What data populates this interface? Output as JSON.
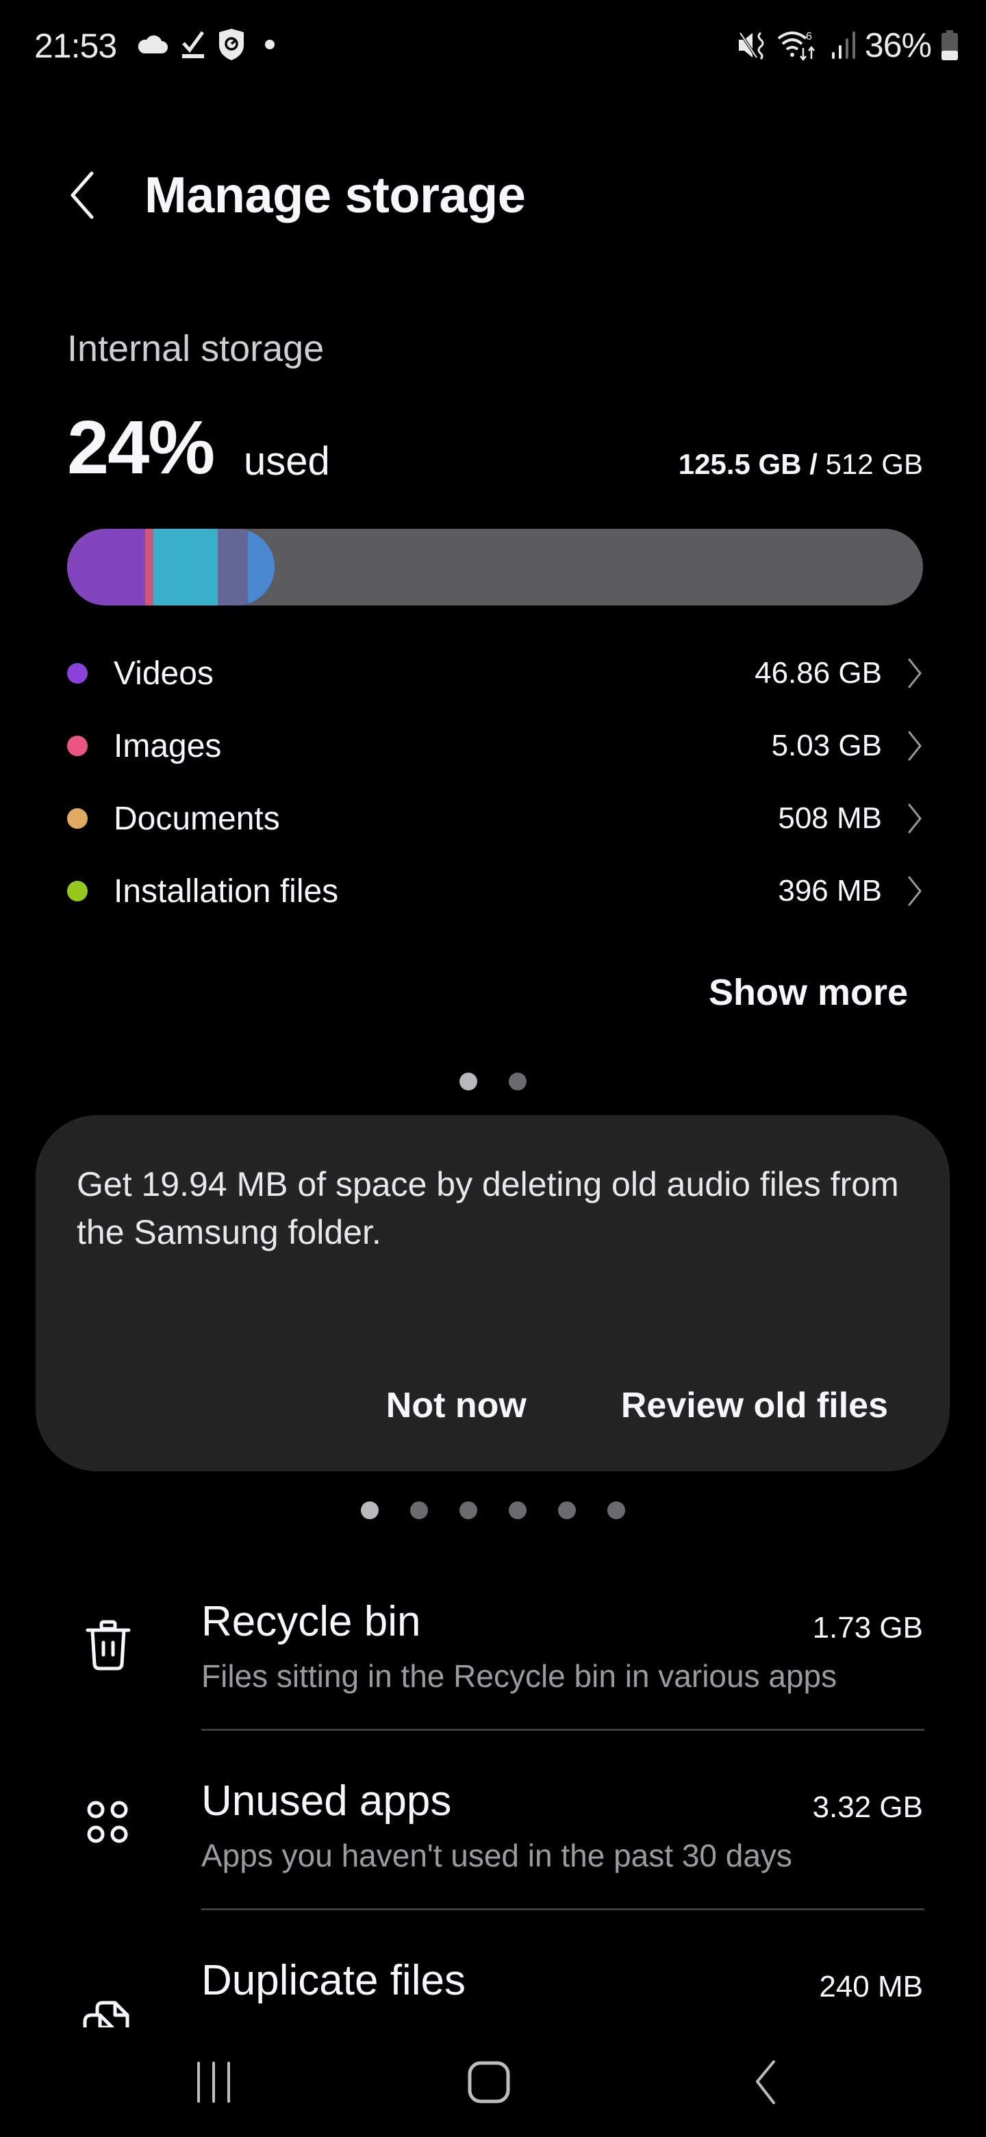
{
  "status_bar": {
    "time": "21:53",
    "left_icons": [
      "cloud-icon",
      "download-done-icon",
      "shield-icon",
      "notification-dot-icon"
    ],
    "right_icons": [
      "vibrate-mute-icon",
      "wifi-6-icon",
      "signal-icon"
    ],
    "battery_percent": "36%",
    "battery_level": 0.36
  },
  "header": {
    "back_icon": "chevron-left-icon",
    "title": "Manage storage"
  },
  "storage": {
    "label": "Internal storage",
    "used_percent": "24%",
    "used_word": "used",
    "used_amount": "125.5 GB",
    "separator": " / ",
    "total_amount": "512 GB",
    "used_fraction": 0.24,
    "bar_segments": [
      {
        "name": "videos",
        "color": "#8345be",
        "fraction": 0.091
      },
      {
        "name": "images",
        "color": "#d0567a",
        "fraction": 0.01
      },
      {
        "name": "other-1",
        "color": "#38b0c9",
        "fraction": 0.075
      },
      {
        "name": "other-2",
        "color": "#646795",
        "fraction": 0.035
      },
      {
        "name": "other-3",
        "color": "#4a89cf",
        "fraction": 0.031
      }
    ],
    "bar_track_color": "#5c5c5e"
  },
  "categories": [
    {
      "name": "Videos",
      "size": "46.86 GB",
      "color": "#8a43d8"
    },
    {
      "name": "Images",
      "size": "5.03 GB",
      "color": "#ea5683"
    },
    {
      "name": "Documents",
      "size": "508 MB",
      "color": "#e0ac62"
    },
    {
      "name": "Installation files",
      "size": "396 MB",
      "color": "#97c91d"
    }
  ],
  "show_more_label": "Show more",
  "pager_top": {
    "count": 2,
    "active": 0
  },
  "suggestion_card": {
    "text": "Get 19.94 MB of space by deleting old audio files from the Samsung folder.",
    "secondary_action": "Not now",
    "primary_action": "Review old files"
  },
  "pager_cards": {
    "count": 6,
    "active": 0
  },
  "optimize_items": [
    {
      "icon": "trash-icon",
      "title": "Recycle bin",
      "size": "1.73 GB",
      "subtitle": "Files sitting in the Recycle bin in various apps"
    },
    {
      "icon": "unused-apps-icon",
      "title": "Unused apps",
      "size": "3.32 GB",
      "subtitle": "Apps you haven't used in the past 30 days"
    },
    {
      "icon": "duplicate-files-icon",
      "title": "Duplicate files",
      "size": "240 MB",
      "subtitle": ""
    }
  ],
  "nav_bar": {
    "buttons": [
      "recents-icon",
      "home-icon",
      "back-icon"
    ]
  }
}
